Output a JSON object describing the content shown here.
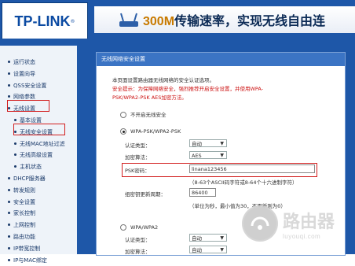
{
  "brand": {
    "logo": "TP-LINK",
    "logo_mark": "®"
  },
  "banner": {
    "prefix": "300M",
    "text": "传输速率，实现无线自由连"
  },
  "sidebar": {
    "items": [
      {
        "label": "运行状态"
      },
      {
        "label": "设置向导"
      },
      {
        "label": "QSS安全设置"
      },
      {
        "label": "网络参数"
      },
      {
        "label": "无线设置"
      },
      {
        "label": "基本设置"
      },
      {
        "label": "无线安全设置"
      },
      {
        "label": "无线MAC地址过滤"
      },
      {
        "label": "无线高级设置"
      },
      {
        "label": "主机状态"
      },
      {
        "label": "DHCP服务器"
      },
      {
        "label": "转发规则"
      },
      {
        "label": "安全设置"
      },
      {
        "label": "家长控制"
      },
      {
        "label": "上网控制"
      },
      {
        "label": "路由功能"
      },
      {
        "label": "IP带宽控制"
      },
      {
        "label": "IP与MAC绑定"
      }
    ]
  },
  "panel": {
    "title": "无线网络安全设置",
    "intro": "本页面设置路由器无线网络的安全认证选项。",
    "warning_line1": "安全提示：为保障网络安全，强烈推荐开启安全设置，并使用WPA-",
    "warning_line2": "PSK/WPA2-PSK AES加密方法。",
    "option_off": "不开启无线安全",
    "option_wpa_psk": "WPA-PSK/WPA2-PSK",
    "auth_label": "认证类型：",
    "auth_value": "自动",
    "enc_label": "加密算法：",
    "enc_value": "AES",
    "psk_label": "PSK密码：",
    "psk_value": "linana123456",
    "psk_hint": "（8-63个ASCII码字符或8-64个十六进制字符）",
    "group_label": "组密钥更新周期：",
    "group_value": "86400",
    "group_hint": "（单位为秒，最小值为30，不更新则为0）",
    "option_wpa": "WPA/WPA2",
    "auth2_label": "认证类型：",
    "auth2_value": "自动",
    "enc2_label": "加密算法：",
    "enc2_value": "自动"
  },
  "watermark": {
    "big": "路由器",
    "small": "luyouqi.com"
  }
}
